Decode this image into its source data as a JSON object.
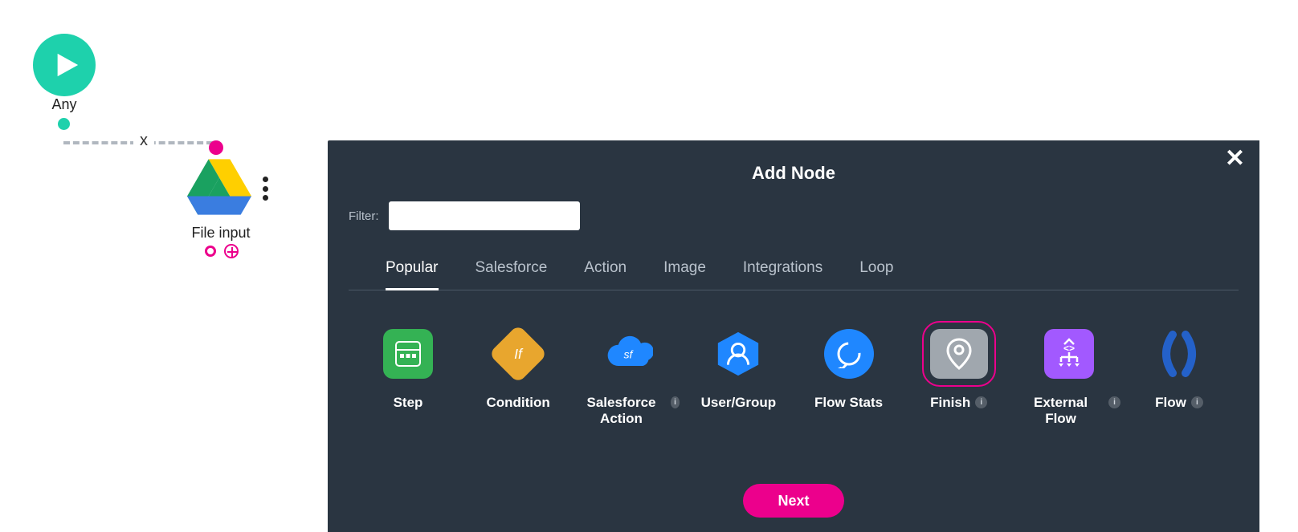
{
  "canvas": {
    "start_node_label": "Any",
    "connector_delete_char": "x",
    "drive_node_label": "File input"
  },
  "panel": {
    "title": "Add Node",
    "close_char": "✕",
    "filter_label": "Filter:",
    "filter_value": "",
    "tabs": [
      "Popular",
      "Salesforce",
      "Action",
      "Image",
      "Integrations",
      "Loop"
    ],
    "active_tab": "Popular",
    "nodes": {
      "step": "Step",
      "condition": "Condition",
      "sfaction": "Salesforce Action",
      "usergroup": "User/Group",
      "flowstats": "Flow Stats",
      "finish": "Finish",
      "extflow": "External Flow",
      "flow": "Flow"
    },
    "selected_node": "finish",
    "next_label": "Next",
    "info_char": "i"
  },
  "colors": {
    "teal": "#1ed1ac",
    "pink": "#ec008c",
    "panel": "#2a3541",
    "green": "#34b254",
    "orange": "#e8a62e",
    "blue": "#1f87ff",
    "darkblue": "#2461c9",
    "purple": "#a259ff",
    "grey_tile": "#a0a7ae"
  }
}
